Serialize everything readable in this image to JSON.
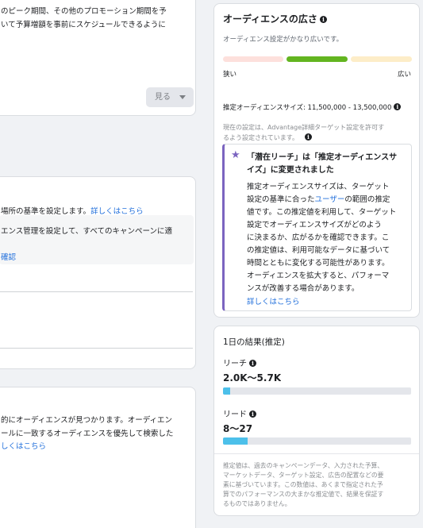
{
  "left": {
    "card1": {
      "line1": "のピーク期間、その他のプロモーション期間を予",
      "line2": "いて予算増額を事前にスケジュールできるように"
    },
    "view_button_label": "見る",
    "card2": {
      "line1": "場所の基準を設定します。",
      "line1_link": "詳しくはこちら",
      "box_line1": "エンス管理を設定して、すべてのキャンペーンに適",
      "box_link": "確認"
    },
    "card3": {
      "line1": "的にオーディエンスが見つかります。オーディエン",
      "line2": "ールに一致するオーディエンスを優先して検索した",
      "link": "しくはこちら"
    }
  },
  "audience": {
    "title": "オーディエンスの広さ",
    "status": "オーディエンス設定がかなり広いです。",
    "gauge_level": "broad-middle",
    "gauge_colors": [
      "#fde0dc",
      "#63b520",
      "#fdedc8"
    ],
    "narrow_label": "狭い",
    "broad_label": "広い",
    "estimated_size": "推定オーディエンスサイズ: 11,500,000 - 13,500,000",
    "note_line1": "現在の設定は、Advantage詳細ターゲット設定を許可す",
    "note_line2": "るよう設定されています。",
    "notice": {
      "title_line1": "「潜在リーチ」は「推定オーディエンスサ",
      "title_line2": "イズ」に変更されました",
      "body_lines": [
        "推定オーディエンスサイズは、ターゲット",
        "設定の基準に合った",
        "の範囲の推定",
        "値です。この推定値を利用して、ターゲット",
        "設定でオーディエンスサイズがどのよう",
        "に決まるか、広がるかを確認できます。こ",
        "の推定値は、利用可能なデータに基づいて",
        "時間とともに変化する可能性があります。",
        "オーディエンスを拡大すると、パフォーマ",
        "ンスが改善する場合があります。"
      ],
      "user_link": "ユーザー",
      "learn_more": "詳しくはこちら"
    }
  },
  "results": {
    "title": "1日の結果(推定)",
    "reach_label": "リーチ",
    "reach_value": "2.0K〜5.7K",
    "reach_fill": 0.04,
    "leads_label": "リード",
    "leads_value": "8〜27",
    "leads_fill": 0.13,
    "disclaimer": [
      "推定値は、過去のキャンペーンデータ、入力された予算、",
      "マーケットデータ、ターゲット設定、広告の配置などの要",
      "素に基づいています。この数値は、あくまで指定された予",
      "算でのパフォーマンスの大まかな推定値で、結果を保証す",
      "るものではありません。"
    ]
  },
  "colors": {
    "accent": "#216fdb",
    "notice_border": "#7b64c0",
    "bar": "#4cc0ea"
  }
}
